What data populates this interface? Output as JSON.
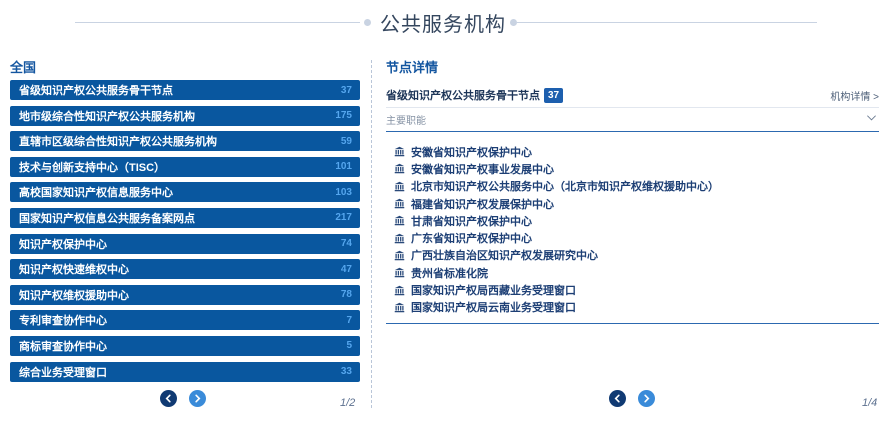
{
  "header": {
    "title": "公共服务机构"
  },
  "left": {
    "section_title": "全国",
    "categories": [
      {
        "label": "省级知识产权公共服务骨干节点",
        "count": "37"
      },
      {
        "label": "地市级综合性知识产权公共服务机构",
        "count": "175"
      },
      {
        "label": "直辖市区级综合性知识产权公共服务机构",
        "count": "59"
      },
      {
        "label": "技术与创新支持中心（TISC）",
        "count": "101"
      },
      {
        "label": "高校国家知识产权信息服务中心",
        "count": "103"
      },
      {
        "label": "国家知识产权信息公共服务备案网点",
        "count": "217"
      },
      {
        "label": "知识产权保护中心",
        "count": "74"
      },
      {
        "label": "知识产权快速维权中心",
        "count": "47"
      },
      {
        "label": "知识产权维权援助中心",
        "count": "78"
      },
      {
        "label": "专利审查协作中心",
        "count": "7"
      },
      {
        "label": "商标审查协作中心",
        "count": "5"
      },
      {
        "label": "综合业务受理窗口",
        "count": "33"
      }
    ],
    "pagination": {
      "page_label": "1/2"
    }
  },
  "right": {
    "section_title": "节点详情",
    "node_name": "省级知识产权公共服务骨干节点",
    "node_count": "37",
    "detail_link": "机构详情 >",
    "function_label": "主要职能",
    "organizations": [
      "安徽省知识产权保护中心",
      "安徽省知识产权事业发展中心",
      "北京市知识产权公共服务中心（北京市知识产权维权援助中心）",
      "福建省知识产权发展保护中心",
      "甘肃省知识产权保护中心",
      "广东省知识产权保护中心",
      "广西壮族自治区知识产权发展研究中心",
      "贵州省标准化院",
      "国家知识产权局西藏业务受理窗口",
      "国家知识产权局云南业务受理窗口"
    ],
    "pagination": {
      "page_label": "1/4"
    }
  },
  "icons": {
    "prev": "chevron-left-icon",
    "next": "chevron-right-icon",
    "org": "institution-icon",
    "expand": "chevron-down-icon"
  },
  "colors": {
    "category_bg": "#09579f",
    "category_count": "#55a6ee",
    "accent": "#1456a0",
    "badge": "#1d5fae"
  }
}
